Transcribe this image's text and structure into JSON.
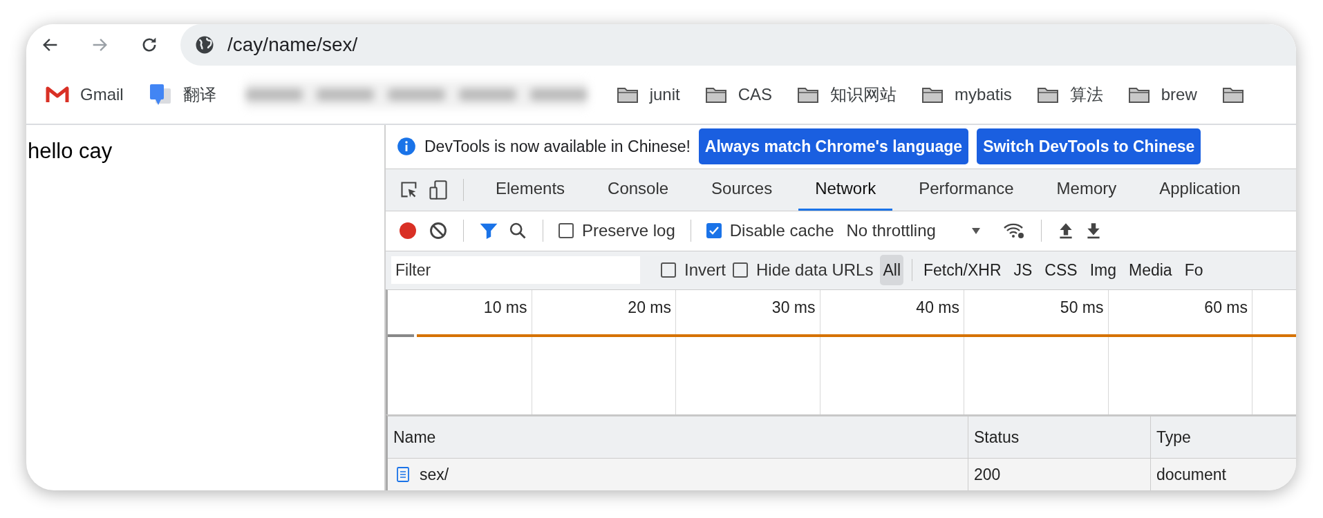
{
  "nav_buttons": [
    {
      "kind": "back",
      "disabled": false
    },
    {
      "kind": "forward",
      "disabled": true
    },
    {
      "kind": "reload",
      "disabled": false
    }
  ],
  "address_bar": {
    "url": "/cay/name/sex/"
  },
  "bookmarks": [
    {
      "kind": "gmail",
      "label": "Gmail"
    },
    {
      "kind": "translate",
      "label": "翻译"
    },
    {
      "kind": "redacted"
    },
    {
      "kind": "folder",
      "label": "junit"
    },
    {
      "kind": "folder",
      "label": "CAS"
    },
    {
      "kind": "folder",
      "label": "知识网站"
    },
    {
      "kind": "folder",
      "label": "mybatis"
    },
    {
      "kind": "folder",
      "label": "算法"
    },
    {
      "kind": "folder",
      "label": "brew"
    },
    {
      "kind": "folder"
    }
  ],
  "page": {
    "text": "hello cay"
  },
  "devtools": {
    "infobar": {
      "message": "DevTools is now available in Chinese!",
      "buttons": [
        "Always match Chrome's language",
        "Switch DevTools to Chinese"
      ]
    },
    "tabs": [
      {
        "label": "Elements",
        "selected": false
      },
      {
        "label": "Console",
        "selected": false
      },
      {
        "label": "Sources",
        "selected": false
      },
      {
        "label": "Network",
        "selected": true
      },
      {
        "label": "Performance",
        "selected": false
      },
      {
        "label": "Memory",
        "selected": false
      },
      {
        "label": "Application",
        "selected": false
      }
    ],
    "toolbar": {
      "recording": true,
      "filter_shown": true,
      "preserve_log": {
        "label": "Preserve log",
        "checked": false
      },
      "disable_cache": {
        "label": "Disable cache",
        "checked": true
      },
      "throttling": "No throttling"
    },
    "filter": {
      "placeholder": "Filter",
      "invert": {
        "label": "Invert",
        "checked": false
      },
      "hide_data_urls": {
        "label": "Hide data URLs",
        "checked": false
      },
      "types": [
        {
          "label": "All",
          "selected": true
        },
        {
          "label": "Fetch/XHR",
          "selected": false
        },
        {
          "label": "JS",
          "selected": false
        },
        {
          "label": "CSS",
          "selected": false
        },
        {
          "label": "Img",
          "selected": false
        },
        {
          "label": "Media",
          "selected": false
        },
        {
          "label": "Fo",
          "selected": false
        }
      ]
    },
    "timeline": {
      "ticks": [
        "10 ms",
        "20 ms",
        "30 ms",
        "40 ms",
        "50 ms",
        "60 ms"
      ]
    },
    "table": {
      "columns": [
        "Name",
        "Status",
        "Type"
      ],
      "rows": [
        {
          "name": "sex/",
          "status": "200",
          "type": "document"
        }
      ]
    }
  }
}
